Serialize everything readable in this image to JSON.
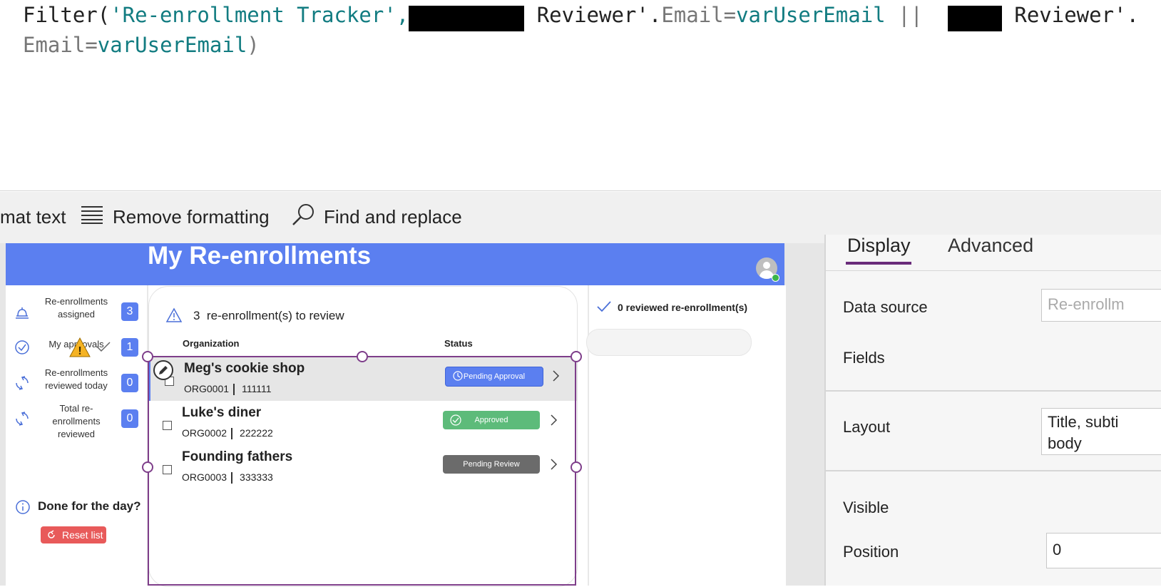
{
  "formula": {
    "func": "Filter(",
    "source": "'Re-enrollment Tracker',",
    "part1": " Reviewer'.",
    "field1": "Email",
    "eq": "=",
    "var1": "varUserEmail",
    "or": " || ",
    "part2": " Reviewer'.",
    "field2": "Email",
    "var2": "varUserEmail",
    "close": ")"
  },
  "toolbar": {
    "format_text": "mat text",
    "remove_formatting": "Remove formatting",
    "find_replace": "Find and replace"
  },
  "app": {
    "title": "My Re-enrollments",
    "nav": [
      {
        "label": "Re-enrollments assigned",
        "count": "3"
      },
      {
        "label": "My approvals",
        "count": "1"
      },
      {
        "label": "Re-enrollments reviewed today",
        "count": "0"
      },
      {
        "label": "Total re-enrollments reviewed",
        "count": "0"
      }
    ],
    "done_label": "Done for the day?",
    "reset_label": "Reset list",
    "to_review_count": "3",
    "to_review_label": "re-enrollment(s) to review",
    "columns": {
      "organization": "Organization",
      "status": "Status"
    },
    "rows": [
      {
        "name": "Meg's cookie shop",
        "id": "ORG0001",
        "code": "111111",
        "status": "Pending Approval"
      },
      {
        "name": "Luke's diner",
        "id": "ORG0002",
        "code": "222222",
        "status": "Approved"
      },
      {
        "name": "Founding fathers",
        "id": "ORG0003",
        "code": "333333",
        "status": "Pending Review"
      }
    ],
    "reviewed_label": "0 reviewed re-enrollment(s)"
  },
  "props": {
    "tabs": {
      "display": "Display",
      "advanced": "Advanced"
    },
    "data_source_label": "Data source",
    "data_source_value": "Re-enrollm",
    "fields_label": "Fields",
    "layout_label": "Layout",
    "layout_value": "Title, subti body",
    "visible_label": "Visible",
    "position_label": "Position",
    "position_value": "0"
  },
  "colors": {
    "header": "#5b7ff0",
    "pending_approval": "#5b7ff0",
    "approved": "#5dbb7a",
    "pending_review": "#6b6b6b",
    "reset": "#e85a5a",
    "selection": "#7e3e8a"
  }
}
